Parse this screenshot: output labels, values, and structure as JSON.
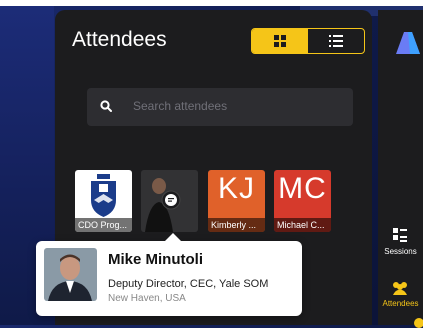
{
  "panel": {
    "title": "Attendees",
    "search_placeholder": "Search attendees",
    "view_toggle": {
      "grid_icon": "grid-icon",
      "list_icon": "list-icon",
      "active": "grid"
    }
  },
  "attendees": [
    {
      "label": "CDO Prog...",
      "avatar": "logo",
      "initials": ""
    },
    {
      "label": "",
      "avatar": "photo",
      "initials": ""
    },
    {
      "label": "Kimberly ...",
      "avatar": "initials",
      "initials": "KJ",
      "color": "#e0612a"
    },
    {
      "label": "Michael C...",
      "avatar": "initials",
      "initials": "MC",
      "color": "#d63a2c"
    }
  ],
  "popover": {
    "name": "Mike Minutoli",
    "title": "Deputy Director, CEC, Yale SOM",
    "location": "New Haven, USA"
  },
  "sidebar": {
    "items": [
      {
        "label": "Sessions",
        "icon": "sessions-icon"
      },
      {
        "label": "Attendees",
        "icon": "attendees-icon"
      }
    ]
  },
  "colors": {
    "accent": "#f5c518",
    "panel_bg": "#1c1c1e",
    "search_bg": "#2d2d31"
  }
}
